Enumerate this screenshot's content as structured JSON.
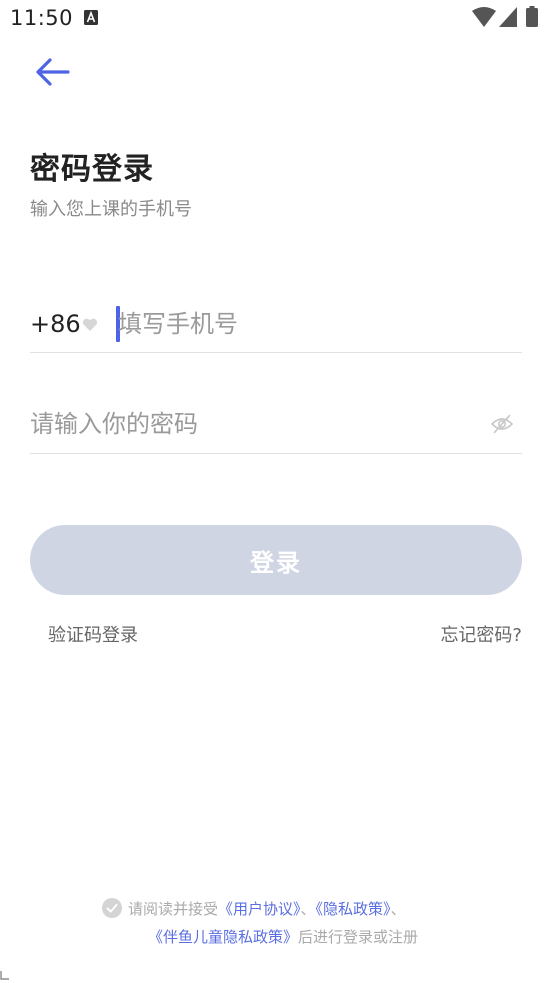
{
  "status_bar": {
    "time": "11:50",
    "icons": [
      "a-notification-icon",
      "wifi-icon",
      "signal-icon",
      "battery-icon"
    ]
  },
  "header": {
    "back_icon": "arrow-left-icon"
  },
  "main": {
    "title": "密码登录",
    "subtitle": "输入您上课的手机号",
    "phone": {
      "country_code": "+86",
      "placeholder": "填写手机号",
      "value": ""
    },
    "password": {
      "placeholder": "请输入你的密码",
      "value": ""
    },
    "login_label": "登录",
    "sms_login_label": "验证码登录",
    "forgot_password_label": "忘记密码?"
  },
  "agreement": {
    "prefix": "请阅读并接受",
    "user_agreement": "《用户协议》",
    "sep1": "、",
    "privacy_policy": "《隐私政策》",
    "sep2": "、",
    "child_privacy_policy": "《伴鱼儿童隐私政策》",
    "suffix": "后进行登录或注册"
  },
  "colors": {
    "accent": "#4f63e6",
    "link": "#5b6ee0",
    "button_disabled": "#d0d5e4",
    "text_primary": "#222222",
    "text_secondary": "#8a8a8a"
  }
}
